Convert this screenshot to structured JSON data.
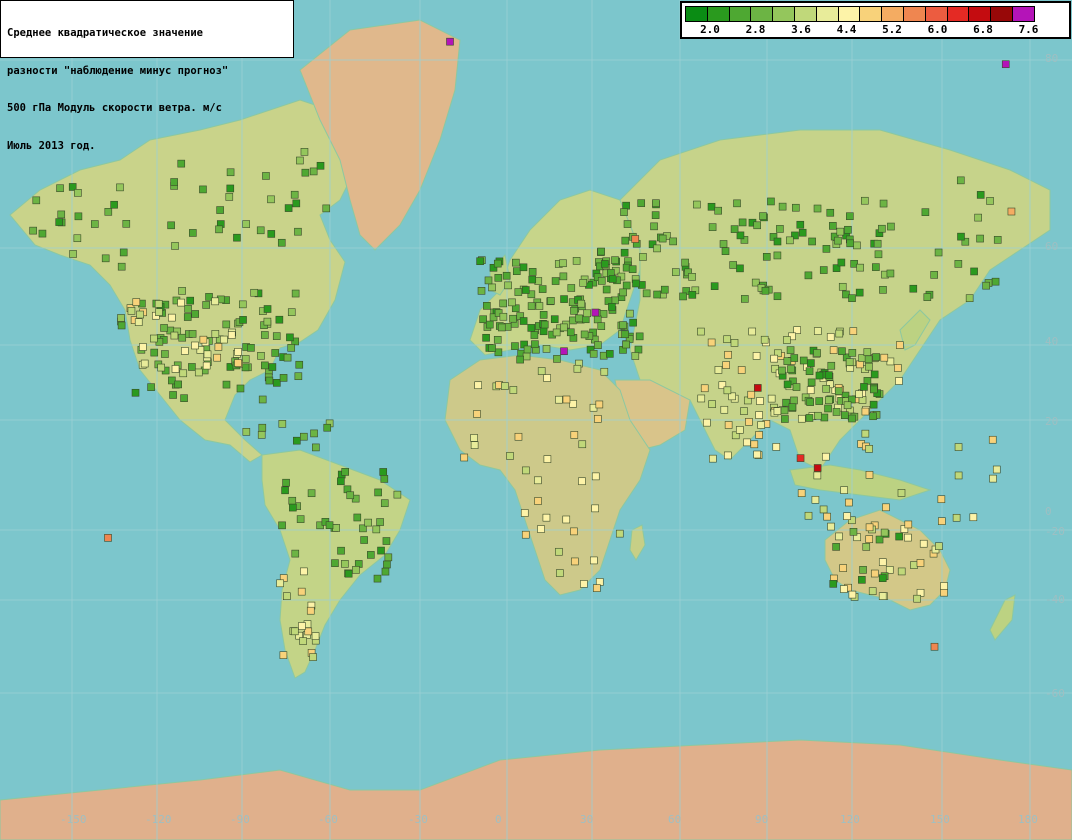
{
  "title": {
    "lines": [
      "Среднее квадратическое значение",
      "разности \"наблюдение минус прогноз\"",
      "500 гПа Модуль скорости ветра. м/с",
      "Июль 2013 год."
    ]
  },
  "legend": {
    "colors": [
      "#0a8c14",
      "#2a9a1e",
      "#4ea832",
      "#6cb444",
      "#94c65c",
      "#c0d87a",
      "#e8ec9a",
      "#fdf3a8",
      "#f8d27a",
      "#f4ac62",
      "#ef8650",
      "#ec5c40",
      "#e42a24",
      "#c40c10",
      "#980808",
      "#b414b8"
    ],
    "labels": [
      "2.0",
      "2.8",
      "3.6",
      "4.4",
      "5.2",
      "6.0",
      "6.8",
      "7.6"
    ]
  },
  "axes": {
    "lon_labels": [
      "-150",
      "-120",
      "-90",
      "-60",
      "-30",
      "0",
      "30",
      "60",
      "90",
      "120",
      "150",
      "180"
    ],
    "lat_labels": [
      "80",
      "60",
      "40",
      "20",
      "0",
      "-20",
      "-40",
      "-60"
    ]
  },
  "map_data": {
    "type": "station-map",
    "projection": "mercator",
    "special_stations": [
      {
        "lon": -20,
        "lat": 65,
        "color": "#b414b8"
      },
      {
        "lon": 175,
        "lat": 63,
        "color": "#b414b8"
      },
      {
        "lon": 31,
        "lat": 30,
        "color": "#b414b8"
      },
      {
        "lon": 20,
        "lat": 23,
        "color": "#b414b8"
      },
      {
        "lon": 88,
        "lat": 16,
        "color": "#c40c10"
      },
      {
        "lon": 109,
        "lat": 0,
        "color": "#c40c10"
      },
      {
        "lon": 103,
        "lat": 2,
        "color": "#e42a24"
      },
      {
        "lon": -140,
        "lat": -14,
        "color": "#ef8650"
      },
      {
        "lon": 177,
        "lat": 46,
        "color": "#f4ac62"
      },
      {
        "lon": 45,
        "lat": 42,
        "color": "#ef8650"
      },
      {
        "lon": 150,
        "lat": -34,
        "color": "#ef8650"
      }
    ]
  }
}
